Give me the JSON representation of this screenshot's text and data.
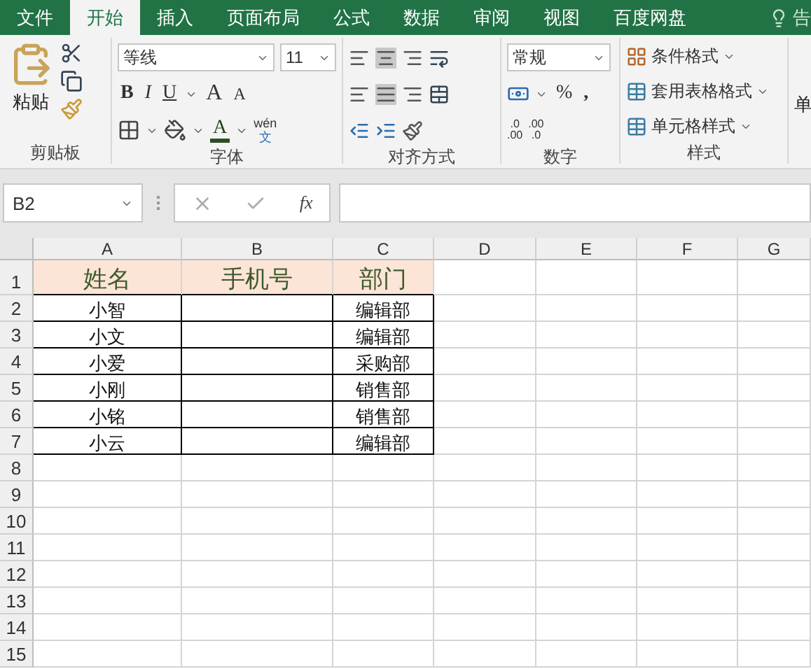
{
  "tabs": [
    {
      "label": "文件",
      "selected": false
    },
    {
      "label": "开始",
      "selected": true
    },
    {
      "label": "插入",
      "selected": false
    },
    {
      "label": "页面布局",
      "selected": false
    },
    {
      "label": "公式",
      "selected": false
    },
    {
      "label": "数据",
      "selected": false
    },
    {
      "label": "审阅",
      "selected": false
    },
    {
      "label": "视图",
      "selected": false
    },
    {
      "label": "百度网盘",
      "selected": false
    }
  ],
  "tell_me": "告",
  "clipboard": {
    "paste": "粘贴",
    "label": "剪贴板"
  },
  "font": {
    "name": "等线",
    "size": "11",
    "bold": "B",
    "italic": "I",
    "underline": "U",
    "grow": "A",
    "shrink": "A",
    "font_color": "A",
    "phonetic_top": "wén",
    "phonetic_bottom": "文",
    "label": "字体"
  },
  "alignment": {
    "label": "对齐方式"
  },
  "number": {
    "format": "常规",
    "percent": "%",
    "comma": ",",
    "increase_decimal": [
      ".0",
      ".00"
    ],
    "decrease_decimal": [
      ".00",
      ".0"
    ],
    "label": "数字"
  },
  "styles": {
    "items": [
      "条件格式",
      "套用表格格式",
      "单元格样式"
    ],
    "label": "样式"
  },
  "cells": {
    "label": "单"
  },
  "name_box": "B2",
  "function_label": "fx",
  "columns": [
    "A",
    "B",
    "C",
    "D",
    "E",
    "F",
    "G"
  ],
  "rows": [
    {
      "number": "1",
      "kind": "header",
      "name": "姓名",
      "phone": "手机号",
      "department": "部门"
    },
    {
      "number": "2",
      "kind": "data",
      "name": "小智",
      "department": "编辑部"
    },
    {
      "number": "3",
      "kind": "data",
      "name": "小文",
      "department": "编辑部"
    },
    {
      "number": "4",
      "kind": "data",
      "name": "小爱",
      "department": "采购部"
    },
    {
      "number": "5",
      "kind": "data",
      "name": "小刚",
      "department": "销售部"
    },
    {
      "number": "6",
      "kind": "data",
      "name": "小铭",
      "department": "销售部"
    },
    {
      "number": "7",
      "kind": "data",
      "name": "小云",
      "department": "编辑部"
    },
    {
      "number": "8",
      "kind": "empty"
    },
    {
      "number": "9",
      "kind": "empty"
    },
    {
      "number": "10",
      "kind": "empty"
    },
    {
      "number": "11",
      "kind": "empty"
    },
    {
      "number": "12",
      "kind": "empty"
    },
    {
      "number": "13",
      "kind": "empty"
    },
    {
      "number": "14",
      "kind": "empty"
    },
    {
      "number": "15",
      "kind": "empty"
    }
  ]
}
